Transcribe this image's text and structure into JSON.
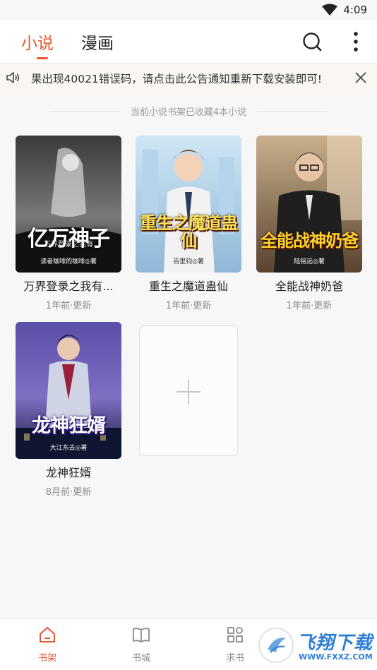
{
  "status_bar": {
    "time": "4:09"
  },
  "header": {
    "tabs": [
      {
        "label": "小说",
        "active": true
      },
      {
        "label": "漫画",
        "active": false
      }
    ]
  },
  "notice": {
    "text": "果出现40021错误码，请点击此公告通知重新下载安装即可!"
  },
  "shelf": {
    "summary": "当前小说书架已收藏4本小说",
    "books": [
      {
        "title": "万界登录之我有...",
        "updated": "1年前·更新",
        "cover_title": "亿万神子",
        "cover_subtitle": "万界登录之我有",
        "cover_author": "读者咖啡的咖啡◎著",
        "cover_style": "dark-gray"
      },
      {
        "title": "重生之魔道蛊仙",
        "updated": "1年前·更新",
        "cover_title": "重生之魔道蛊仙",
        "cover_author": "百里钧◎著",
        "cover_style": "light-blue"
      },
      {
        "title": "全能战神奶爸",
        "updated": "1年前·更新",
        "cover_title": "全能战神奶爸",
        "cover_author": "陆铭远◎著",
        "cover_style": "warm-dark"
      },
      {
        "title": "龙神狂婿",
        "updated": "8月前·更新",
        "cover_title": "龙神狂婿",
        "cover_author": "大江东去◎著",
        "cover_style": "purple-night"
      }
    ],
    "add_book_icon": "plus-icon"
  },
  "bottom_nav": {
    "items": [
      {
        "label": "书架",
        "icon": "bookshelf-icon",
        "active": true
      },
      {
        "label": "书城",
        "icon": "book-icon",
        "active": false
      },
      {
        "label": "求书",
        "icon": "grid-icon",
        "active": false
      }
    ]
  },
  "watermark": {
    "text": "飞翔下载",
    "url": "WWW.FXXZ.COM"
  },
  "colors": {
    "accent": "#e8562f",
    "background": "#f7f7f7"
  }
}
